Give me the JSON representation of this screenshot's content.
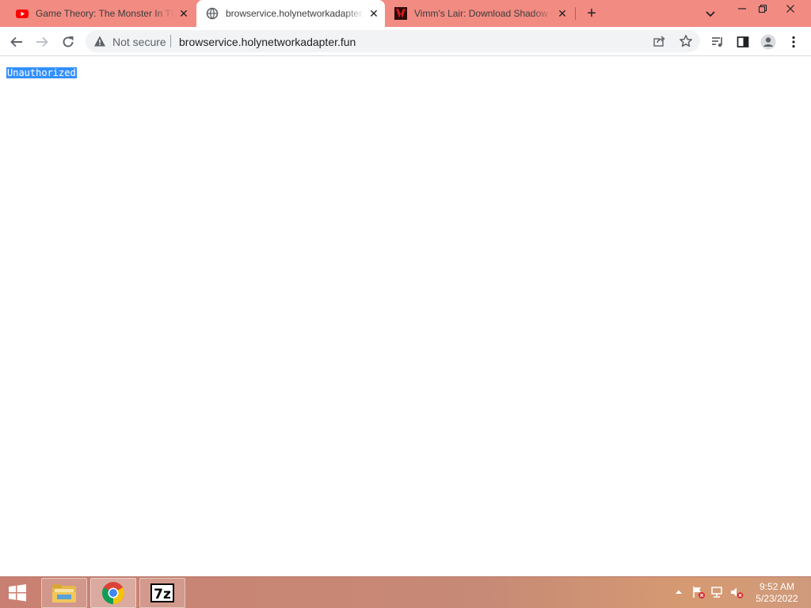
{
  "tabs": [
    {
      "title": "Game Theory: The Monster In The",
      "favicon": "youtube-icon",
      "active": false
    },
    {
      "title": "browservice.holynetworkadapter.fun",
      "favicon": "globe-icon",
      "active": true
    },
    {
      "title": "Vimm's Lair: Download Shadow of",
      "favicon": "vimms-lair-icon",
      "active": false
    }
  ],
  "omnibox": {
    "security_label": "Not secure",
    "url": "browservice.holynetworkadapter.fun"
  },
  "page": {
    "text": "Unauthorized"
  },
  "taskbar": {
    "apps": [
      "file-explorer-icon",
      "chrome-icon",
      "7zip-icon"
    ],
    "time": "9:52 AM",
    "date": "5/23/2022"
  },
  "colors": {
    "tabstrip": "#f28b82",
    "selection": "#3390ff",
    "taskbar": "#c98072"
  }
}
